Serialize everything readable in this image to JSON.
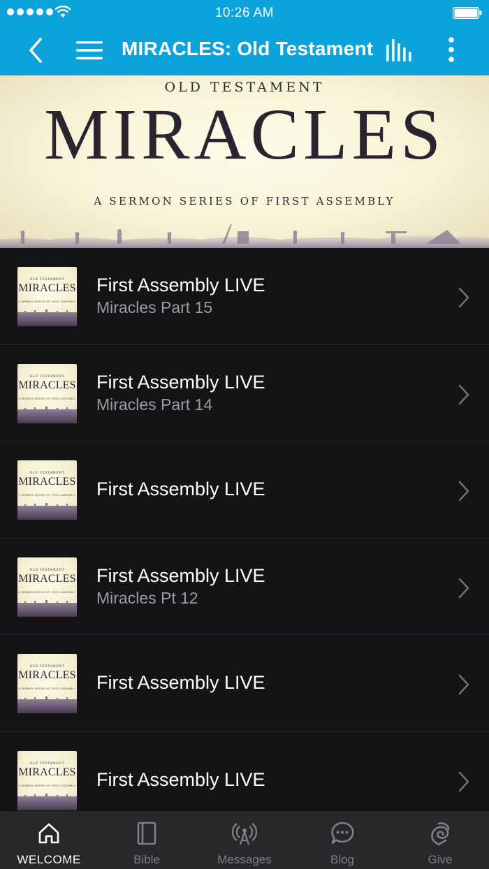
{
  "status_bar": {
    "time": "10:26 AM"
  },
  "nav": {
    "title": "MIRACLES: Old Testament"
  },
  "hero": {
    "kicker": "OLD TESTAMENT",
    "title": "MIRACLES",
    "subtitle": "A SERMON SERIES OF FIRST ASSEMBLY"
  },
  "thumb": {
    "kicker": "OLD TESTAMENT",
    "title": "MIRACLES",
    "subtitle": "A SERMON SERIES OF FIRST ASSEMBLY"
  },
  "episodes": [
    {
      "title": "First Assembly LIVE",
      "subtitle": "Miracles Part 15"
    },
    {
      "title": "First Assembly LIVE",
      "subtitle": "Miracles Part 14"
    },
    {
      "title": "First Assembly LIVE",
      "subtitle": ""
    },
    {
      "title": "First Assembly LIVE",
      "subtitle": "Miracles Pt 12"
    },
    {
      "title": "First Assembly LIVE",
      "subtitle": ""
    },
    {
      "title": "First Assembly LIVE",
      "subtitle": ""
    }
  ],
  "tabs": [
    {
      "label": "WELCOME",
      "icon": "home-icon",
      "active": true
    },
    {
      "label": "Bible",
      "icon": "book-icon",
      "active": false
    },
    {
      "label": "Messages",
      "icon": "broadcast-icon",
      "active": false
    },
    {
      "label": "Blog",
      "icon": "chat-bubble-icon",
      "active": false
    },
    {
      "label": "Give",
      "icon": "give-icon",
      "active": false
    }
  ],
  "colors": {
    "header": "#0ba3da",
    "list_background": "#141416",
    "tab_bar": "#28282b",
    "tab_inactive": "#7e7e84"
  }
}
